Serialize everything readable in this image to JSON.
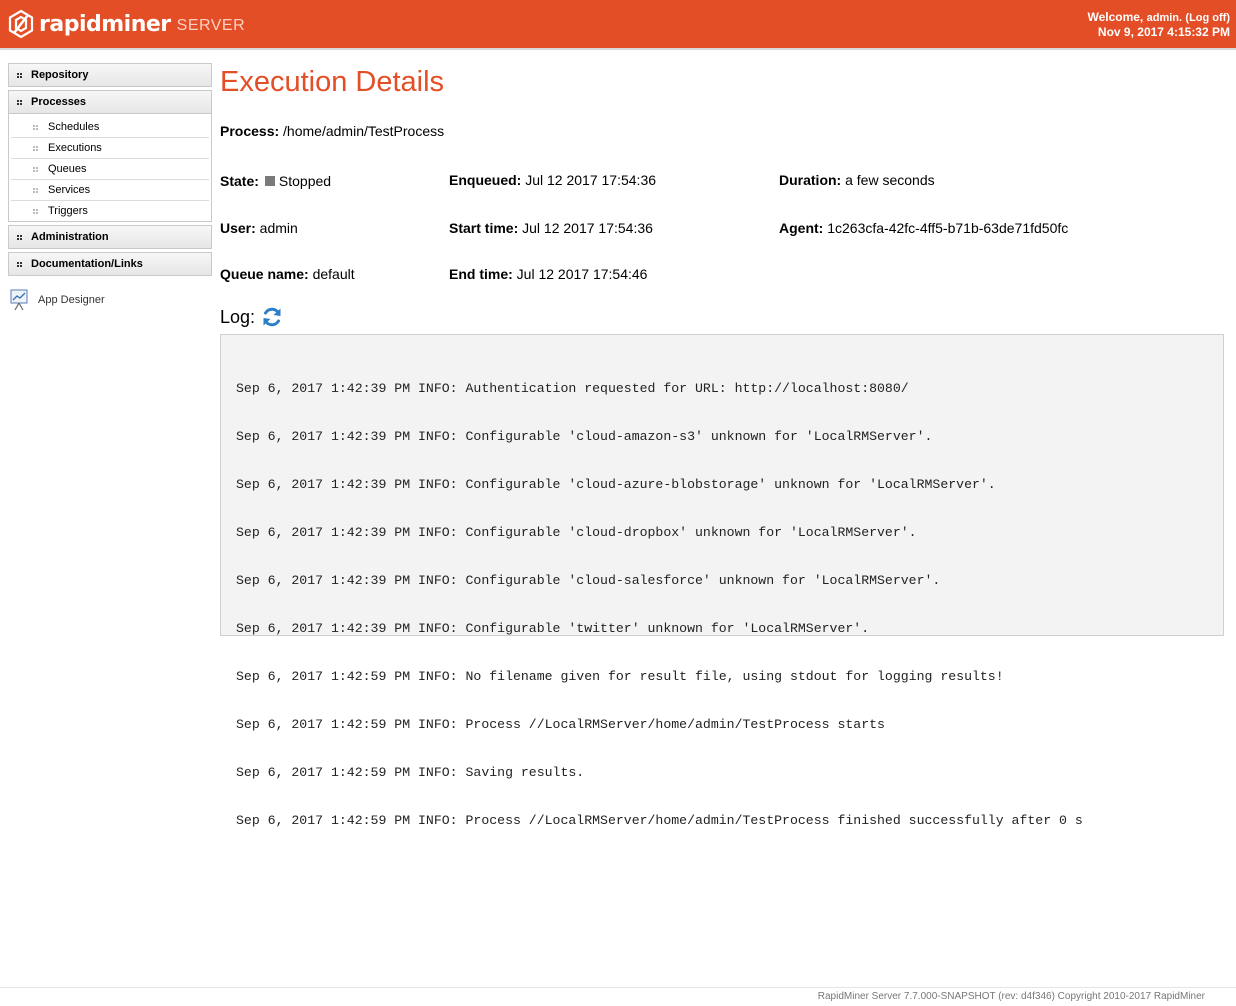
{
  "header": {
    "logo_text": "rapidminer",
    "logo_sub": "SERVER",
    "welcome_text": "Welcome, ",
    "user_link": "admin.",
    "logoff_link": "(Log off)",
    "datetime": "Nov 9, 2017 4:15:32 PM",
    "brand_color": "#e34e26"
  },
  "sidebar": {
    "repository": "Repository",
    "processes": "Processes",
    "process_items": [
      "Schedules",
      "Executions",
      "Queues",
      "Services",
      "Triggers"
    ],
    "administration": "Administration",
    "documentation": "Documentation/Links",
    "app_designer": "App Designer"
  },
  "main": {
    "title": "Execution Details",
    "process_label": "Process:",
    "process_value": " /home/admin/TestProcess",
    "state_label": "State:",
    "state_value": "Stopped",
    "enqueued_label": "Enqueued:",
    "enqueued_value": " Jul 12 2017 17:54:36",
    "duration_label": "Duration:",
    "duration_value": " a few seconds",
    "user_label": "User:",
    "user_value": " admin",
    "start_label": "Start time:",
    "start_value": " Jul 12 2017 17:54:36",
    "agent_label": "Agent:",
    "agent_value": " 1c263cfa-42fc-4ff5-b71b-63de71fd50fc",
    "queue_label": "Queue name:",
    "queue_value": " default",
    "end_label": "End time:",
    "end_value": " Jul 12 2017 17:54:46",
    "log_label": "Log:",
    "log_lines": [
      "Sep 6, 2017 1:42:39 PM INFO: Authentication requested for URL: http://localhost:8080/",
      "Sep 6, 2017 1:42:39 PM INFO: Configurable 'cloud-amazon-s3' unknown for 'LocalRMServer'.",
      "Sep 6, 2017 1:42:39 PM INFO: Configurable 'cloud-azure-blobstorage' unknown for 'LocalRMServer'.",
      "Sep 6, 2017 1:42:39 PM INFO: Configurable 'cloud-dropbox' unknown for 'LocalRMServer'.",
      "Sep 6, 2017 1:42:39 PM INFO: Configurable 'cloud-salesforce' unknown for 'LocalRMServer'.",
      "Sep 6, 2017 1:42:39 PM INFO: Configurable 'twitter' unknown for 'LocalRMServer'.",
      "Sep 6, 2017 1:42:59 PM INFO: No filename given for result file, using stdout for logging results!",
      "Sep 6, 2017 1:42:59 PM INFO: Process //LocalRMServer/home/admin/TestProcess starts",
      "Sep 6, 2017 1:42:59 PM INFO: Saving results.",
      "Sep 6, 2017 1:42:59 PM INFO: Process //LocalRMServer/home/admin/TestProcess finished successfully after 0 s"
    ]
  },
  "footer": {
    "text": "RapidMiner Server 7.7.000-SNAPSHOT (rev: d4f346) Copyright 2010-2017 RapidMiner"
  }
}
